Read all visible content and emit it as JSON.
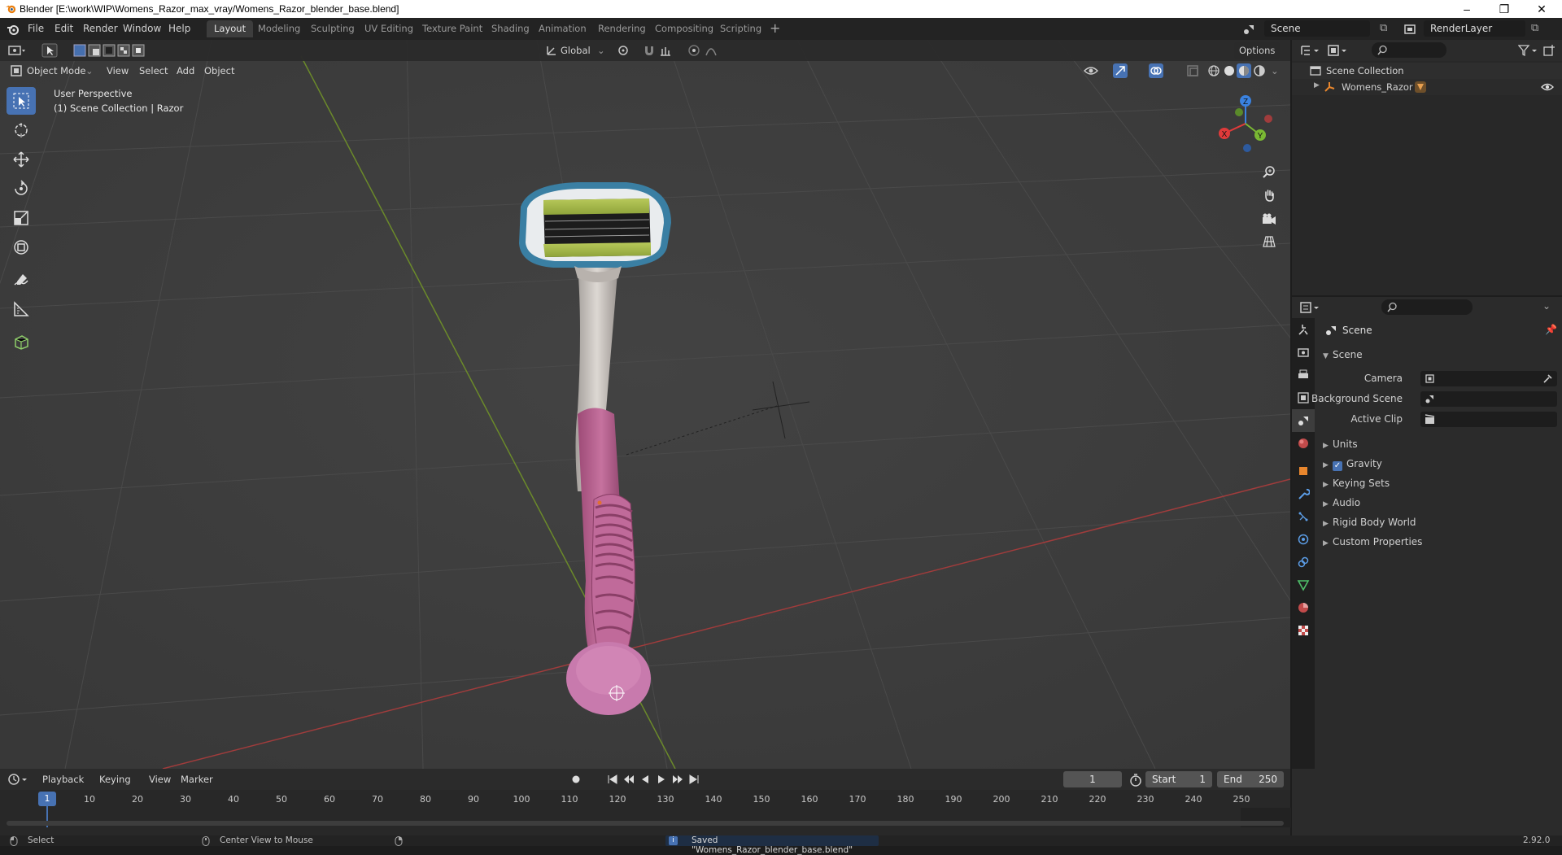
{
  "window": {
    "title": "Blender [E:\\work\\WIP\\Womens_Razor_max_vray/Womens_Razor_blender_base.blend]"
  },
  "menu": {
    "items": [
      "File",
      "Edit",
      "Render",
      "Window",
      "Help"
    ]
  },
  "workspaces": {
    "tabs": [
      "Layout",
      "Modeling",
      "Sculpting",
      "UV Editing",
      "Texture Paint",
      "Shading",
      "Animation",
      "Rendering",
      "Compositing",
      "Scripting"
    ],
    "active": "Layout"
  },
  "scene_selector": {
    "value": "Scene"
  },
  "viewlayer_selector": {
    "value": "RenderLayer"
  },
  "viewport": {
    "orientation": "Global",
    "options_label": "Options",
    "mode": "Object Mode",
    "menus": [
      "View",
      "Select",
      "Add",
      "Object"
    ],
    "info_line1": "User Perspective",
    "info_line2": "(1) Scene Collection | Razor",
    "gizmo_axes": {
      "x": "X",
      "y": "Y",
      "z": "Z"
    }
  },
  "outliner": {
    "root": "Scene Collection",
    "items": [
      {
        "label": "Womens_Razor"
      }
    ]
  },
  "properties": {
    "header": "Scene",
    "panel": "Scene",
    "fields": [
      {
        "label": "Camera"
      },
      {
        "label": "Background Scene"
      },
      {
        "label": "Active Clip"
      }
    ],
    "sections": [
      "Units",
      "Gravity",
      "Keying Sets",
      "Audio",
      "Rigid Body World",
      "Custom Properties"
    ],
    "gravity_checked": true
  },
  "timeline": {
    "menus": [
      "Playback",
      "Keying",
      "View",
      "Marker"
    ],
    "current_frame": "1",
    "start_label": "Start",
    "start": "1",
    "end_label": "End",
    "end": "250",
    "ticks": [
      "1",
      "10",
      "20",
      "30",
      "40",
      "50",
      "60",
      "70",
      "80",
      "90",
      "100",
      "110",
      "120",
      "130",
      "140",
      "150",
      "160",
      "170",
      "180",
      "190",
      "200",
      "210",
      "220",
      "230",
      "240",
      "250"
    ]
  },
  "status": {
    "left": "Select",
    "middle": "Center View to Mouse",
    "message": "Saved \"Womens_Razor_blender_base.blend\"",
    "version": "2.92.0"
  },
  "colors": {
    "accent": "#4772b3",
    "x_axis": "#e03a3a",
    "y_axis": "#7ab833",
    "z_axis": "#3a82e0",
    "razor_pink": "#c06a9a",
    "razor_grey": "#c9c4c0"
  }
}
